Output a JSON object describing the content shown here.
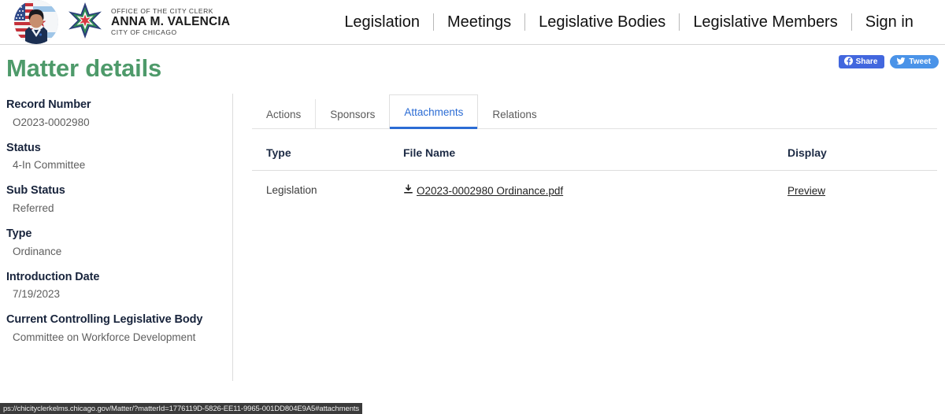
{
  "header": {
    "brand": {
      "line1": "OFFICE OF THE CITY CLERK",
      "line2": "ANNA M. VALENCIA",
      "line3": "CITY OF CHICAGO",
      "avatar_icon": "portrait-avatar-icon",
      "star_icon": "chicago-star-icon"
    },
    "nav": [
      {
        "label": "Legislation"
      },
      {
        "label": "Meetings"
      },
      {
        "label": "Legislative Bodies"
      },
      {
        "label": "Legislative Members"
      },
      {
        "label": "Sign in"
      }
    ]
  },
  "title": {
    "text": "Matter details",
    "color": "#4e9a6a"
  },
  "social": {
    "share_label": "Share",
    "share_icon": "facebook-icon",
    "share_color": "#4267de",
    "tweet_label": "Tweet",
    "tweet_icon": "twitter-bird-icon",
    "tweet_color": "#4a93e8"
  },
  "sidebar": {
    "fields": [
      {
        "label": "Record Number",
        "value": "O2023-0002980"
      },
      {
        "label": "Status",
        "value": "4-In Committee"
      },
      {
        "label": "Sub Status",
        "value": "Referred"
      },
      {
        "label": "Type",
        "value": "Ordinance"
      },
      {
        "label": "Introduction Date",
        "value": "7/19/2023"
      },
      {
        "label": "Current Controlling Legislative Body",
        "value": "Committee on Workforce Development"
      }
    ]
  },
  "main": {
    "tabs": [
      {
        "label": "Actions",
        "active": false
      },
      {
        "label": "Sponsors",
        "active": false
      },
      {
        "label": "Attachments",
        "active": true
      },
      {
        "label": "Relations",
        "active": false
      }
    ],
    "active_tab_color": "#2b6cd4",
    "table": {
      "columns": [
        "Type",
        "File Name",
        "Display"
      ],
      "rows": [
        {
          "type": "Legislation",
          "file_name": "O2023-0002980 Ordinance.pdf",
          "file_icon": "download-icon",
          "display": "Preview"
        }
      ]
    }
  },
  "statusbar": {
    "url": "ps://chicityclerkelms.chicago.gov/Matter/?matterId=1776119D-5826-EE11-9965-001DD804E9A5#attachments"
  }
}
